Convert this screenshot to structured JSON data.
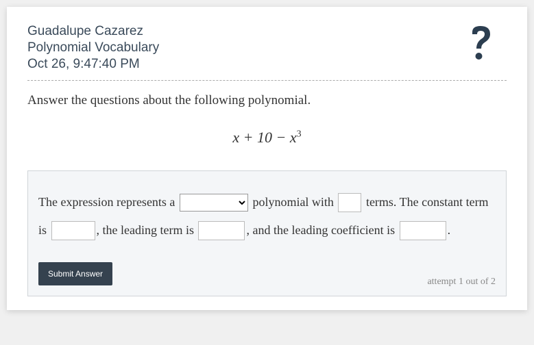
{
  "header": {
    "student_name": "Guadalupe Cazarez",
    "assignment_title": "Polynomial Vocabulary",
    "timestamp": "Oct 26, 9:47:40 PM"
  },
  "question": {
    "prompt": "Answer the questions about the following polynomial.",
    "polynomial_html": "x + 10 − x³"
  },
  "answer": {
    "text1": "The expression represents a ",
    "text2": " polynomial with ",
    "text3": " terms. The constant term is ",
    "text4": ", the leading term is ",
    "text5": ", and the leading coefficient is ",
    "text6": "."
  },
  "buttons": {
    "submit": "Submit Answer"
  },
  "footer": {
    "attempt": "attempt 1 out of 2"
  }
}
